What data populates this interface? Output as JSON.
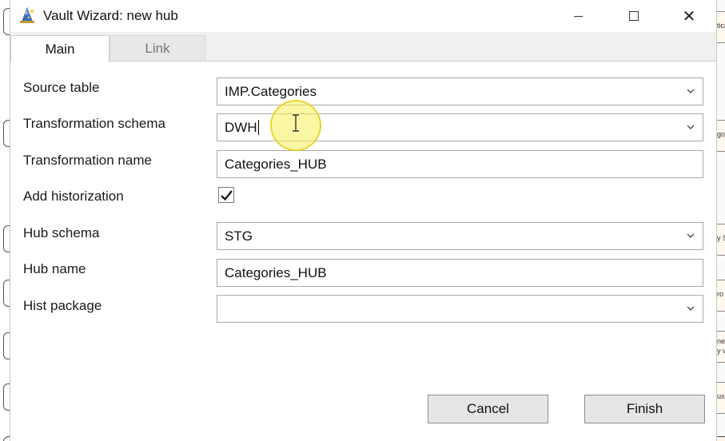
{
  "window": {
    "title": "Vault Wizard: new hub",
    "close_glyph": "✕"
  },
  "tabs": [
    {
      "label": "Main",
      "active": true
    },
    {
      "label": "Link",
      "active": false
    }
  ],
  "form": {
    "source_table": {
      "label": "Source table",
      "value": "IMP.Categories"
    },
    "transformation_schema": {
      "label": "Transformation schema",
      "value": "DWH"
    },
    "transformation_name": {
      "label": "Transformation name",
      "value": "Categories_HUB"
    },
    "add_historization": {
      "label": "Add historization",
      "checked": true
    },
    "hub_schema": {
      "label": "Hub schema",
      "value": "STG"
    },
    "hub_name": {
      "label": "Hub name",
      "value": "Categories_HUB"
    },
    "hist_package": {
      "label": "Hist package",
      "value": ""
    }
  },
  "buttons": {
    "cancel": "Cancel",
    "finish": "Finish"
  },
  "background_fragments": [
    "tica",
    "go",
    "y S",
    "ro",
    "ne\ny v",
    "us"
  ],
  "icons": {
    "app": "wizard-hat-icon",
    "dropdown": "chevron-down-icon",
    "check": "checkmark-icon",
    "cursor": "text-cursor-icon"
  }
}
